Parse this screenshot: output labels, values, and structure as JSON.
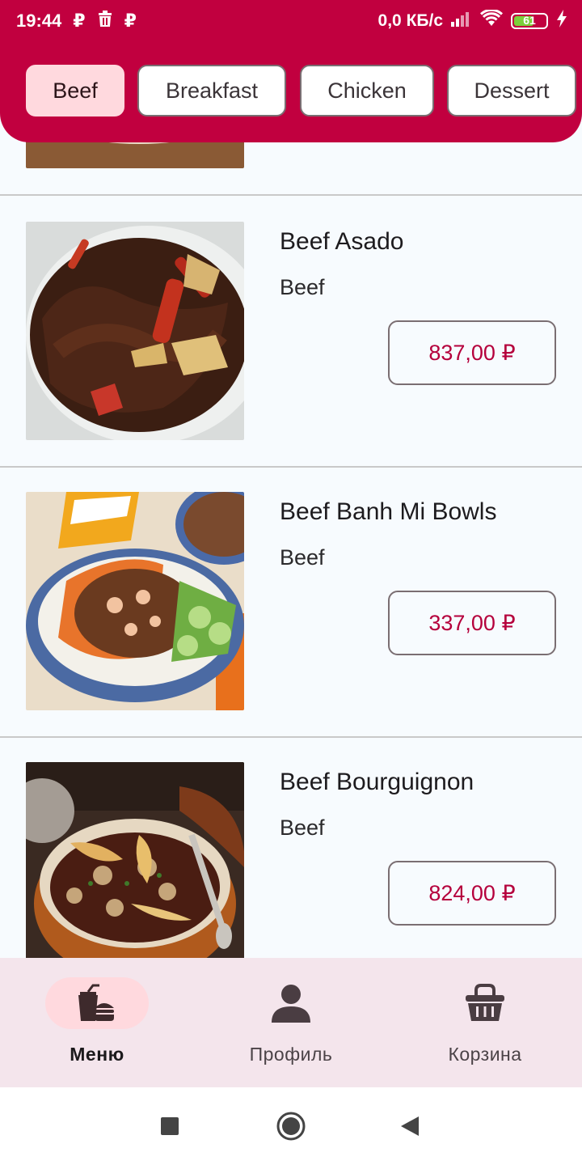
{
  "status_bar": {
    "time": "19:44",
    "left_icons": [
      "ruble-icon",
      "trash-icon",
      "ruble-icon"
    ],
    "left_glyphs": [
      "₽",
      "🗑",
      "₽"
    ],
    "net_speed": "0,0 КБ/с",
    "battery": "61"
  },
  "categories": [
    {
      "label": "Beef",
      "active": true
    },
    {
      "label": "Breakfast",
      "active": false
    },
    {
      "label": "Chicken",
      "active": false
    },
    {
      "label": "Dessert",
      "active": false
    }
  ],
  "menu_items": [
    {
      "name": "Beef Asado",
      "category": "Beef",
      "price": "837,00 ₽"
    },
    {
      "name": "Beef Banh Mi Bowls",
      "category": "Beef",
      "price": "337,00 ₽"
    },
    {
      "name": "Beef Bourguignon",
      "category": "Beef",
      "price": "824,00 ₽"
    }
  ],
  "bottom_nav": [
    {
      "label": "Меню",
      "icon": "food-icon",
      "active": true
    },
    {
      "label": "Профиль",
      "icon": "person-icon",
      "active": false
    },
    {
      "label": "Корзина",
      "icon": "basket-icon",
      "active": false
    }
  ],
  "colors": {
    "primary": "#c1003f",
    "chip_active": "#ffd9de",
    "price_text": "#b5003c",
    "nav_bg": "#f4e5ec"
  }
}
